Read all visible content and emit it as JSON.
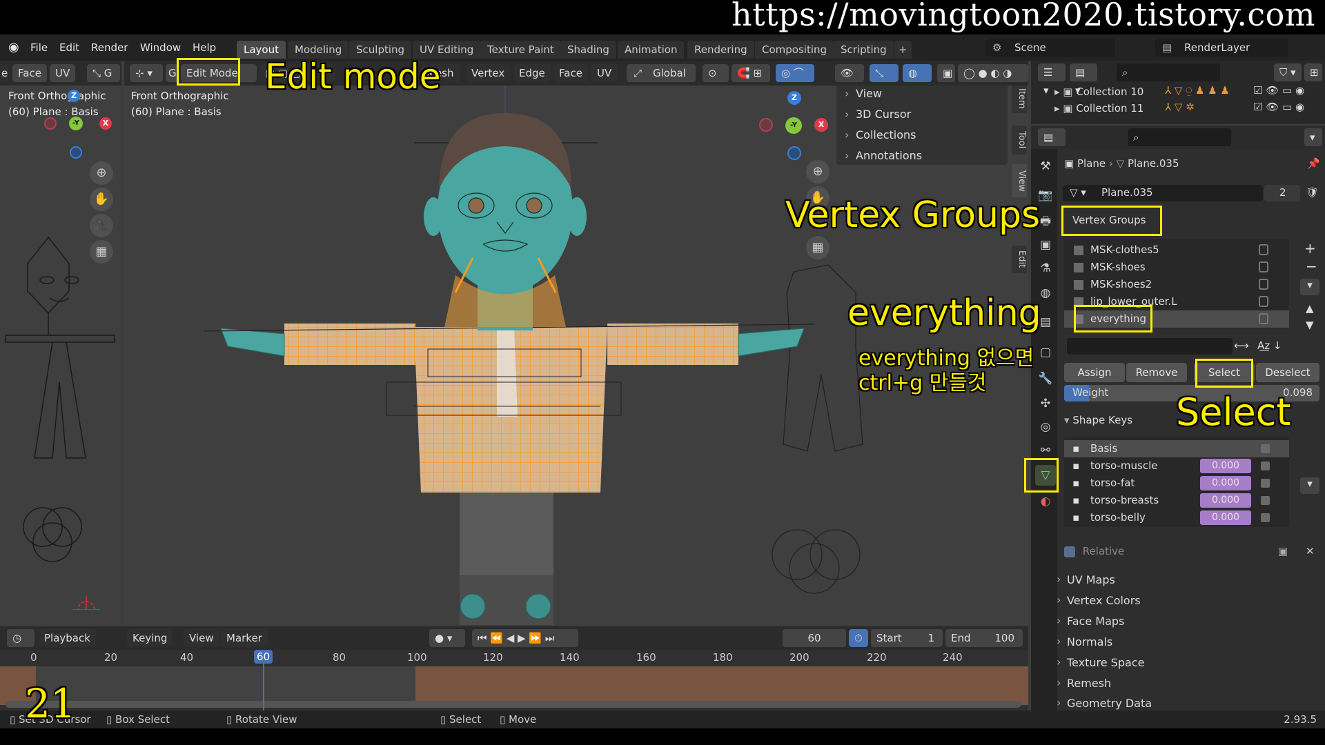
{
  "watermark_url": "https://movingtoon2020.tistory.com",
  "page_number": "21",
  "menu": {
    "items": [
      "File",
      "Edit",
      "Render",
      "Window",
      "Help"
    ],
    "workspaces": [
      "Layout",
      "Modeling",
      "Sculpting",
      "UV Editing",
      "Texture Paint",
      "Shading",
      "Animation",
      "Rendering",
      "Compositing",
      "Scripting"
    ],
    "active_workspace": "Layout",
    "add_tab": "+",
    "scene": "Scene",
    "render_layer": "RenderLayer"
  },
  "left_viewport": {
    "header_items": [
      "Face",
      "UV"
    ],
    "view_name": "Front Orthographic",
    "object_info": "(60) Plane : Basis"
  },
  "main_viewport": {
    "mode": "Edit Mode",
    "header_items": [
      "Mesh",
      "Vertex",
      "Edge",
      "Face",
      "UV"
    ],
    "transform_orientation": "Global",
    "view_name": "Front Orthographic",
    "object_info": "(60) Plane : Basis",
    "sidebar_tabs": [
      "Item",
      "Tool",
      "View",
      "Edit"
    ],
    "view_menu": [
      "View",
      "3D Cursor",
      "Collections",
      "Annotations"
    ],
    "gizmo": {
      "z": "Z",
      "y": "-Y",
      "x": "X"
    }
  },
  "outliner": {
    "rows": [
      {
        "name": "Collection 10"
      },
      {
        "name": "Collection 11"
      }
    ]
  },
  "properties": {
    "breadcrumb_object": "Plane",
    "breadcrumb_mesh": "Plane.035",
    "mesh_name": "Plane.035",
    "mesh_users": "2",
    "vertex_groups_title": "Vertex Groups",
    "vertex_groups": [
      "MSK-clothes5",
      "MSK-shoes",
      "MSK-shoes2",
      "lip_lower_outer.L",
      "everything"
    ],
    "active_vertex_group": "everything",
    "buttons": {
      "assign": "Assign",
      "remove": "Remove",
      "select": "Select",
      "deselect": "Deselect"
    },
    "weight_label": "Weight",
    "weight_value": "0.098",
    "shape_keys_title": "Shape Keys",
    "shape_keys": [
      {
        "name": "Basis",
        "value": ""
      },
      {
        "name": "torso-muscle",
        "value": "0.000"
      },
      {
        "name": "torso-fat",
        "value": "0.000"
      },
      {
        "name": "torso-breasts",
        "value": "0.000"
      },
      {
        "name": "torso-belly",
        "value": "0.000"
      }
    ],
    "relative_label": "Relative",
    "sections": [
      "UV Maps",
      "Vertex Colors",
      "Face Maps",
      "Normals",
      "Texture Space",
      "Remesh",
      "Geometry Data"
    ]
  },
  "timeline": {
    "menus": [
      "Playback",
      "Keying",
      "View",
      "Marker"
    ],
    "current_frame": "60",
    "start_label": "Start",
    "start": "1",
    "end_label": "End",
    "end": "100",
    "ruler": [
      "0",
      "20",
      "40",
      "60",
      "80",
      "100",
      "120",
      "140",
      "160",
      "180",
      "200",
      "220",
      "240"
    ]
  },
  "status": {
    "items": [
      "Set 3D Cursor",
      "Box Select",
      "Rotate View",
      "Select",
      "Move"
    ],
    "version": "2.93.5"
  },
  "callouts": {
    "edit_mode": "Edit mode",
    "vertex_groups": "Vertex Groups",
    "everything": "everything",
    "note_line1": "everything 없으면",
    "note_line2": "ctrl+g 만들것",
    "select": "Select"
  },
  "colors": {
    "highlight": "#ffec00",
    "selection": "#ff9a1f",
    "shape_value": "#a77dc7",
    "skin": "#49a6a0"
  }
}
